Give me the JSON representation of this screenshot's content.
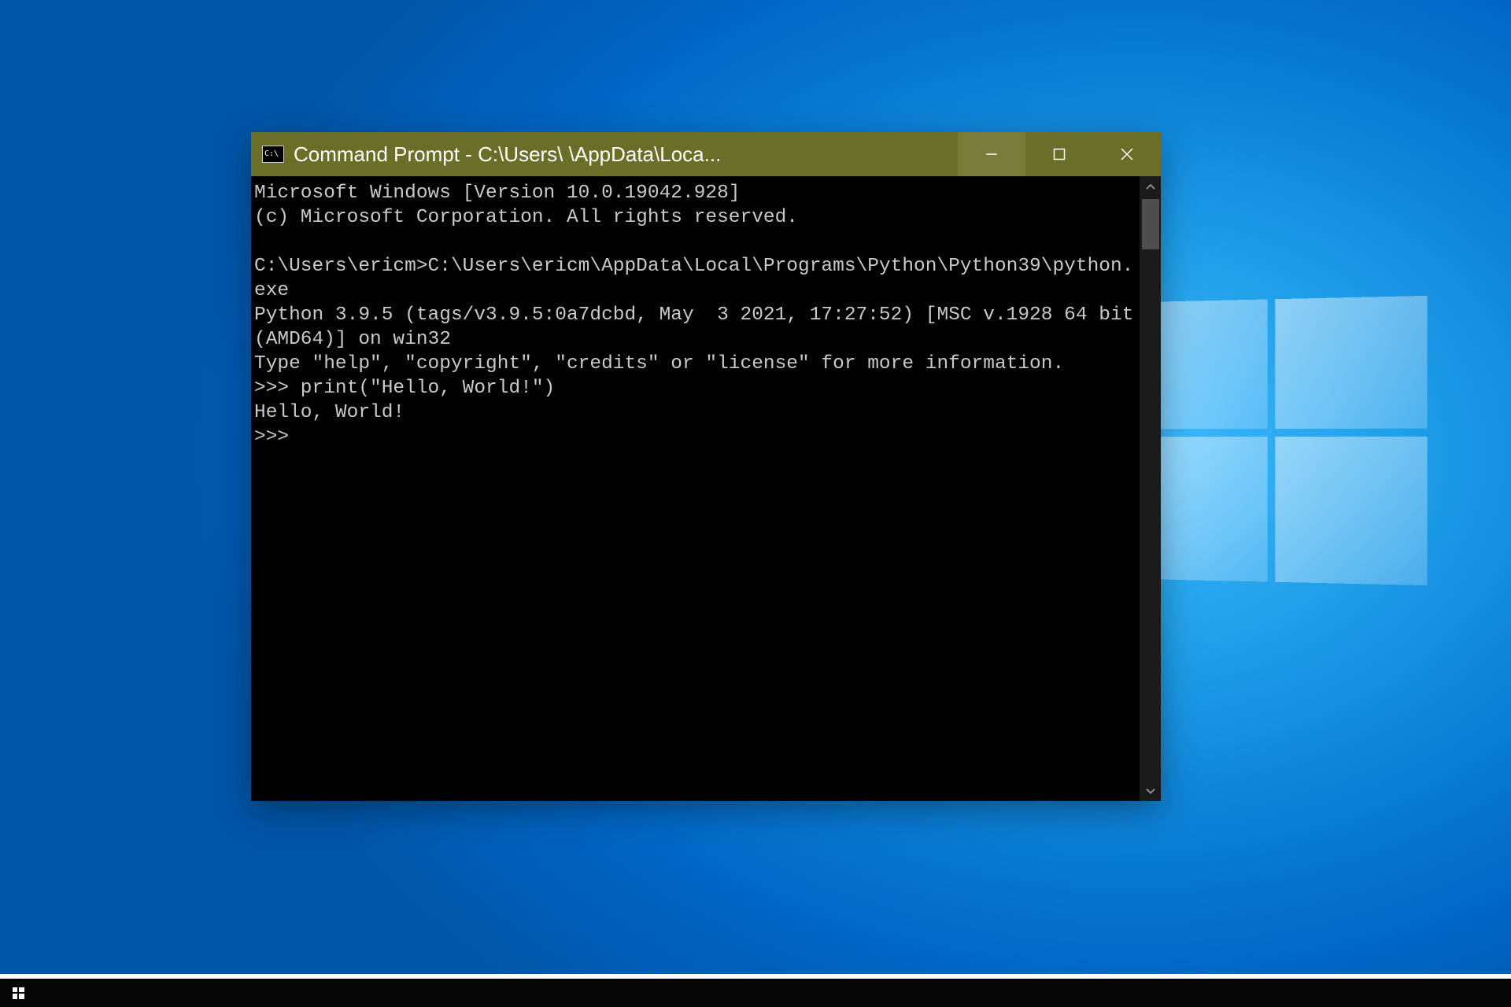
{
  "desktop": {
    "os": "Windows 10"
  },
  "window": {
    "title": "Command Prompt - C:\\Users\\        \\AppData\\Loca...",
    "icon_label": "C:\\"
  },
  "terminal": {
    "lines": [
      "Microsoft Windows [Version 10.0.19042.928]",
      "(c) Microsoft Corporation. All rights reserved.",
      "",
      "C:\\Users\\ericm>C:\\Users\\ericm\\AppData\\Local\\Programs\\Python\\Python39\\python.exe",
      "Python 3.9.5 (tags/v3.9.5:0a7dcbd, May  3 2021, 17:27:52) [MSC v.1928 64 bit (AMD64)] on win32",
      "Type \"help\", \"copyright\", \"credits\" or \"license\" for more information.",
      ">>> print(\"Hello, World!\")",
      "Hello, World!",
      ">>> "
    ]
  }
}
